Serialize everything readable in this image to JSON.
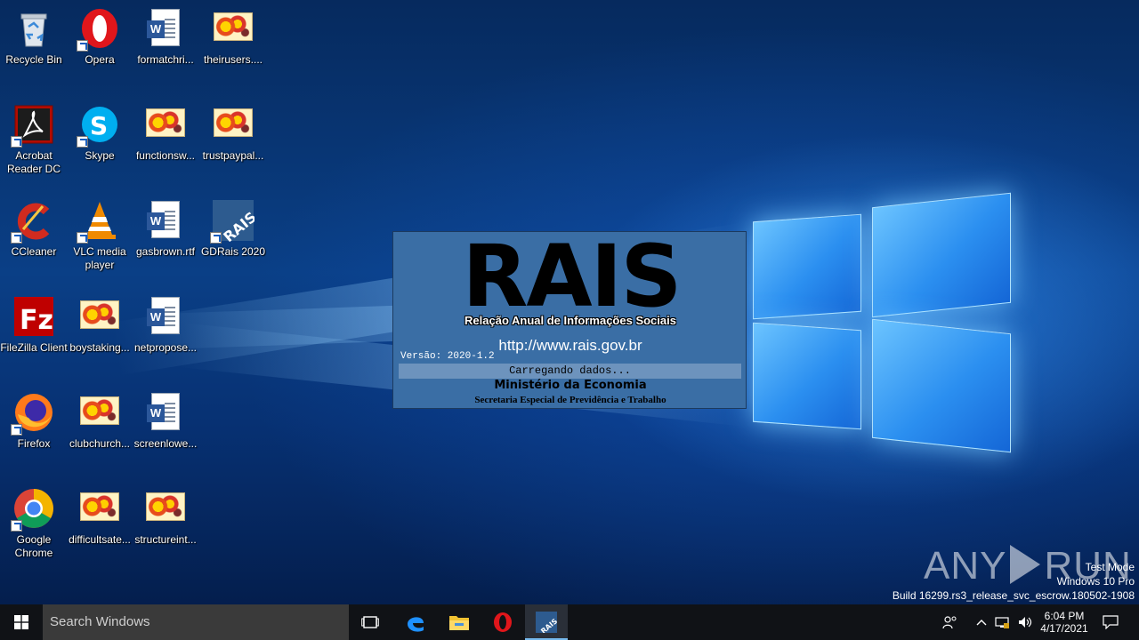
{
  "desktop_icons": [
    {
      "label": "Recycle Bin",
      "icon": "recycle-bin-icon"
    },
    {
      "label": "Opera",
      "icon": "opera-icon"
    },
    {
      "label": "formatchri...",
      "icon": "word-document-icon"
    },
    {
      "label": "theirusers....",
      "icon": "image-file-icon"
    },
    {
      "label": "Acrobat Reader DC",
      "icon": "acrobat-reader-icon"
    },
    {
      "label": "Skype",
      "icon": "skype-icon"
    },
    {
      "label": "functionsw...",
      "icon": "image-file-icon"
    },
    {
      "label": "trustpaypal...",
      "icon": "image-file-icon"
    },
    {
      "label": "CCleaner",
      "icon": "ccleaner-icon"
    },
    {
      "label": "VLC media player",
      "icon": "vlc-icon"
    },
    {
      "label": "gasbrown.rtf",
      "icon": "word-document-icon"
    },
    {
      "label": "GDRais 2020",
      "icon": "gdrais-icon"
    },
    {
      "label": "FileZilla Client",
      "icon": "filezilla-icon"
    },
    {
      "label": "boystaking...",
      "icon": "image-file-icon"
    },
    {
      "label": "netpropose...",
      "icon": "word-document-icon"
    },
    {
      "label": "Firefox",
      "icon": "firefox-icon"
    },
    {
      "label": "clubchurch...",
      "icon": "image-file-icon"
    },
    {
      "label": "screenlowe...",
      "icon": "word-document-icon"
    },
    {
      "label": "Google Chrome",
      "icon": "chrome-icon"
    },
    {
      "label": "difficultsate...",
      "icon": "image-file-icon"
    },
    {
      "label": "structureint...",
      "icon": "image-file-icon"
    }
  ],
  "splash": {
    "logo_text": "RAIS",
    "subtitle": "Relação Anual de Informações Sociais",
    "url": "http://www.rais.gov.br",
    "version": "Versão: 2020-1.2",
    "loading": "Carregando dados...",
    "ministry": "Ministério da Economia",
    "secretariat": "Secretaria Especial de Previdência e Trabalho"
  },
  "watermark": {
    "left": "ANY",
    "right": "RUN"
  },
  "system_info": {
    "line1": "Test Mode",
    "line2": "Windows 10 Pro",
    "line3": "Build 16299.rs3_release_svc_escrow.180502-1908"
  },
  "taskbar": {
    "search_placeholder": "Search Windows",
    "apps": [
      "task-view-icon",
      "edge-icon",
      "file-explorer-icon",
      "opera-icon",
      "gdrais-icon"
    ],
    "time": "6:04 PM",
    "date": "4/17/2021"
  }
}
